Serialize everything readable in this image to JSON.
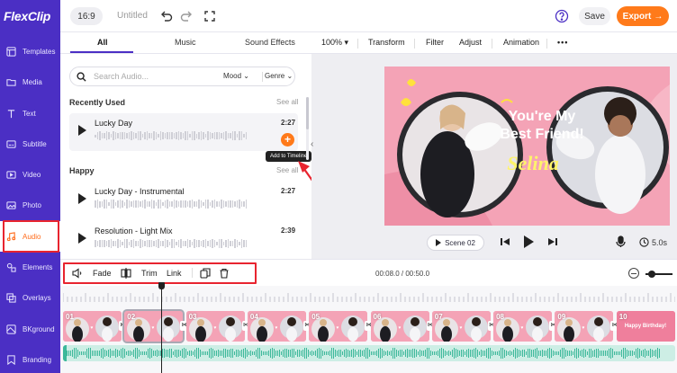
{
  "app": {
    "logo": "FlexClip",
    "ratio": "16:9",
    "title": "Untitled",
    "save_label": "Save",
    "export_label": "Export"
  },
  "sidebar": {
    "items": [
      {
        "label": "Templates",
        "icon": "templates-icon"
      },
      {
        "label": "Media",
        "icon": "media-icon"
      },
      {
        "label": "Text",
        "icon": "text-icon"
      },
      {
        "label": "Subtitle",
        "icon": "subtitle-icon"
      },
      {
        "label": "Video",
        "icon": "video-icon"
      },
      {
        "label": "Photo",
        "icon": "photo-icon"
      },
      {
        "label": "Audio",
        "icon": "audio-icon",
        "active": true
      },
      {
        "label": "Elements",
        "icon": "elements-icon"
      },
      {
        "label": "Overlays",
        "icon": "overlays-icon"
      },
      {
        "label": "BKground",
        "icon": "background-icon"
      },
      {
        "label": "Branding",
        "icon": "branding-icon"
      }
    ]
  },
  "tabs": {
    "all": "All",
    "music": "Music",
    "sound_effects": "Sound Effects"
  },
  "toolbar": {
    "zoom": "100%",
    "transform": "Transform",
    "filter": "Filter",
    "adjust": "Adjust",
    "animation": "Animation"
  },
  "audio_panel": {
    "search_placeholder": "Search Audio...",
    "mood": "Mood",
    "genre": "Genre",
    "recently_used": "Recently Used",
    "happy": "Happy",
    "see_all": "See all",
    "tooltip": "Add to Timeline",
    "tracks": [
      {
        "name": "Lucky Day",
        "duration": "2:27"
      },
      {
        "name": "Lucky Day - Instrumental",
        "duration": "2:27"
      },
      {
        "name": "Resolution - Light Mix",
        "duration": "2:39"
      }
    ]
  },
  "preview": {
    "line1": "You're My",
    "line2": "Best Friend!",
    "name": "Selina",
    "scene": "Scene 02",
    "duration": "5.0s"
  },
  "timeline_toolbar": {
    "fade": "Fade",
    "trim": "Trim",
    "link": "Link",
    "time": "00:08.0 / 00:50.0"
  },
  "timeline": {
    "clips": [
      "01",
      "02",
      "03",
      "04",
      "05",
      "06",
      "07",
      "08",
      "09",
      "10"
    ],
    "last_clip_text": "Happy Birthday!"
  },
  "colors": {
    "brand": "#4b2fc4",
    "accent": "#ff7a1a",
    "highlight": "#e8242f",
    "canvas_bg": "#f4a3b6"
  }
}
